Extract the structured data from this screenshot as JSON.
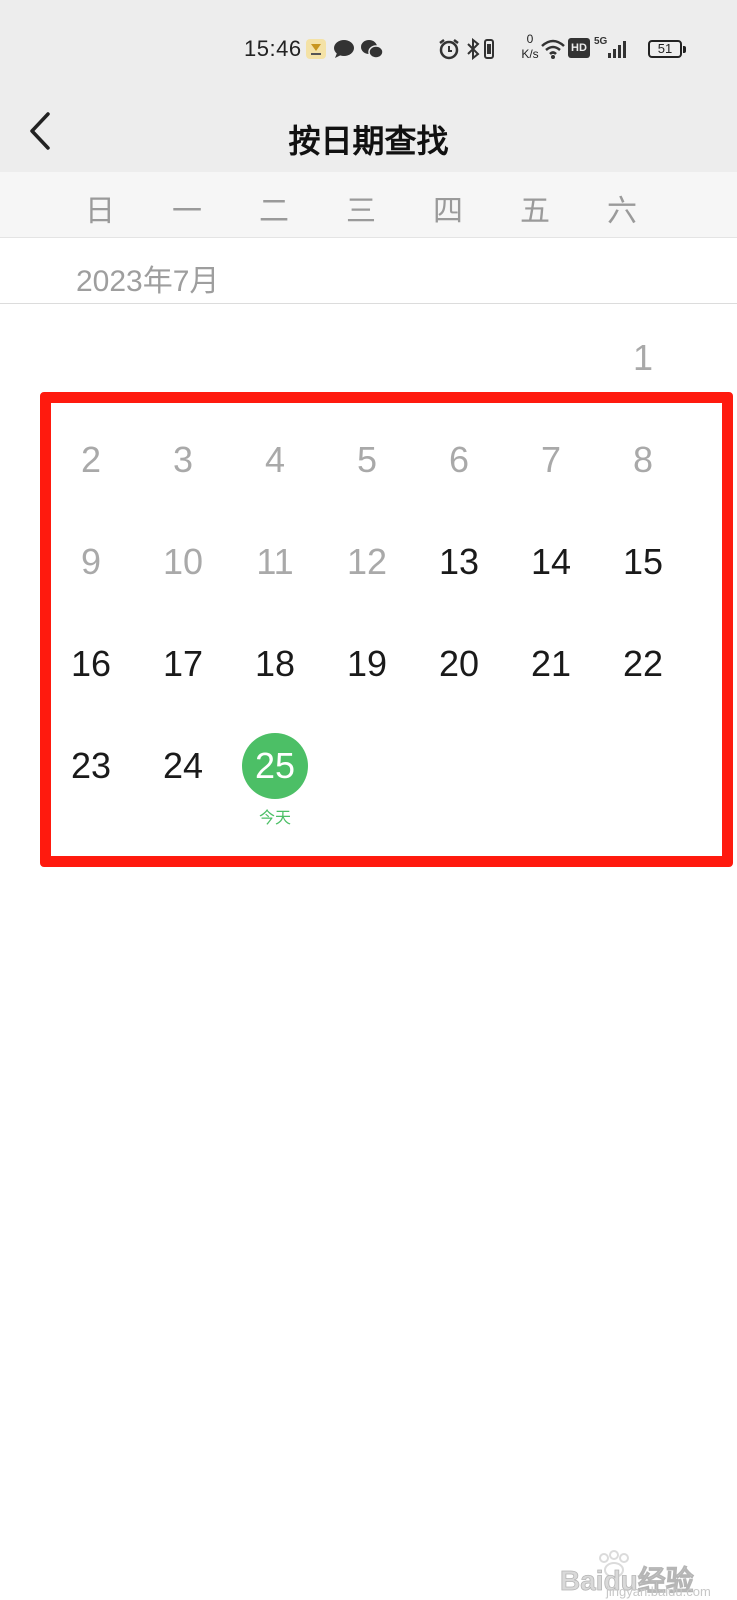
{
  "status_bar": {
    "time": "15:46",
    "net_speed_value": "0",
    "net_speed_unit": "K/s",
    "hd_badge": "HD",
    "network_type": "5G",
    "battery": "51",
    "icons": [
      "app-notification-icon",
      "chat-bubble-icon",
      "wechat-icon",
      "alarm-icon",
      "bluetooth-icon",
      "vibrate-icon",
      "wifi-icon",
      "hd-icon",
      "signal-icon",
      "battery-icon"
    ]
  },
  "navbar": {
    "back_icon": "chevron-left-icon",
    "title": "按日期查找"
  },
  "weekdays": [
    "日",
    "一",
    "二",
    "三",
    "四",
    "五",
    "六"
  ],
  "calendar": {
    "month_label": "2023年7月",
    "first_day_label": "1",
    "rows": [
      [
        "2",
        "3",
        "4",
        "5",
        "6",
        "7",
        "8"
      ],
      [
        "9",
        "10",
        "11",
        "12",
        "13",
        "14",
        "15"
      ],
      [
        "16",
        "17",
        "18",
        "19",
        "20",
        "21",
        "22"
      ],
      [
        "23",
        "24"
      ]
    ],
    "today": {
      "day": "25",
      "label": "今天"
    }
  },
  "colors": {
    "accent_green": "#4cbf66",
    "highlight_red": "#ff1a0e",
    "past_day": "#a9a9a9",
    "active_day": "#1a1a1a"
  },
  "watermark": {
    "brand": "Baidu经验",
    "url": "jingyan.baidu.com"
  }
}
